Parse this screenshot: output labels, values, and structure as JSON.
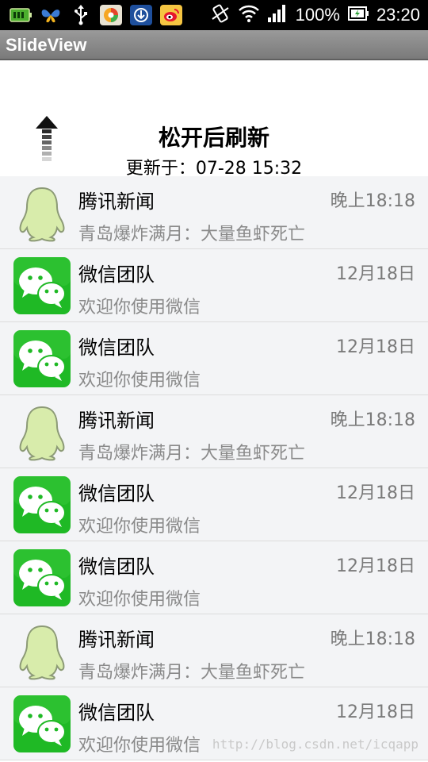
{
  "status_bar": {
    "battery_percent": "100%",
    "time": "23:20",
    "icons": [
      "battery-app-icon",
      "butterfly-icon",
      "usb-icon",
      "browser-icon",
      "downloader-icon",
      "weibo-icon",
      "vibrate-icon",
      "wifi-icon",
      "signal-icon",
      "battery-icon"
    ]
  },
  "action_bar": {
    "title": "SlideView"
  },
  "refresh": {
    "title": "松开后刷新",
    "updated": "更新于：07-28 15:32"
  },
  "list": [
    {
      "type": "qq",
      "avatar": "qq-penguin-icon",
      "title": "腾讯新闻",
      "time": "晚上18:18",
      "message": "青岛爆炸满月：大量鱼虾死亡"
    },
    {
      "type": "wechat",
      "avatar": "wechat-icon",
      "title": "微信团队",
      "time": "12月18日",
      "message": "欢迎你使用微信"
    },
    {
      "type": "wechat",
      "avatar": "wechat-icon",
      "title": "微信团队",
      "time": "12月18日",
      "message": "欢迎你使用微信"
    },
    {
      "type": "qq",
      "avatar": "qq-penguin-icon",
      "title": "腾讯新闻",
      "time": "晚上18:18",
      "message": "青岛爆炸满月：大量鱼虾死亡"
    },
    {
      "type": "wechat",
      "avatar": "wechat-icon",
      "title": "微信团队",
      "time": "12月18日",
      "message": "欢迎你使用微信"
    },
    {
      "type": "wechat",
      "avatar": "wechat-icon",
      "title": "微信团队",
      "time": "12月18日",
      "message": "欢迎你使用微信"
    },
    {
      "type": "qq",
      "avatar": "qq-penguin-icon",
      "title": "腾讯新闻",
      "time": "晚上18:18",
      "message": "青岛爆炸满月：大量鱼虾死亡"
    },
    {
      "type": "wechat",
      "avatar": "wechat-icon",
      "title": "微信团队",
      "time": "12月18日",
      "message": "欢迎你使用微信"
    }
  ],
  "watermark": "http://blog.csdn.net/icqapp",
  "colors": {
    "wechat_green": "#1fb925",
    "qq_body": "#d8ecab",
    "row_bg": "#f3f4f6",
    "action_bar": "#8a8a8a"
  }
}
